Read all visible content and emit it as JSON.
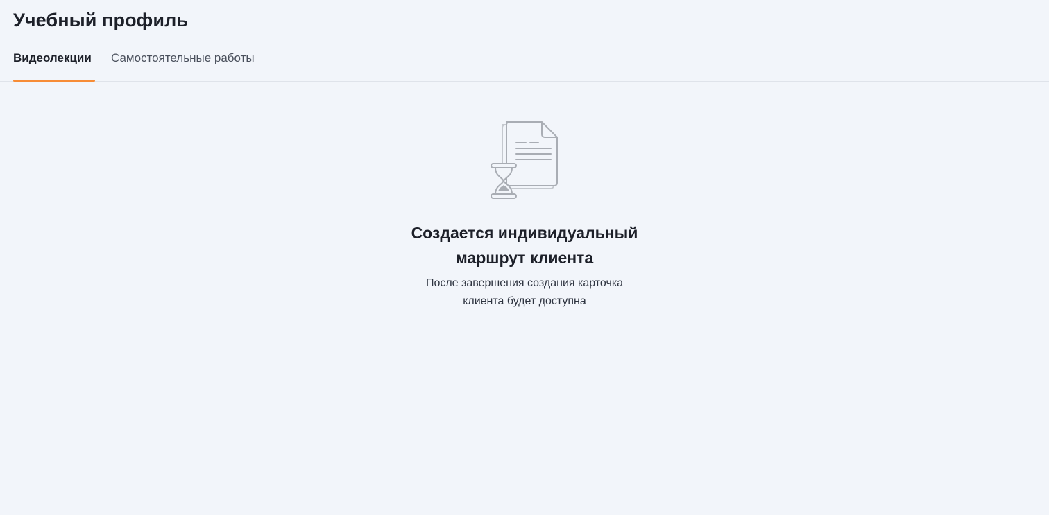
{
  "page": {
    "title": "Учебный профиль"
  },
  "tabs": [
    {
      "label": "Видеолекции",
      "active": true
    },
    {
      "label": "Самостоятельные работы",
      "active": false
    }
  ],
  "empty_state": {
    "icon": "document-hourglass-icon",
    "title_line1": "Создается индивидуальный",
    "title_line2": "маршрут клиента",
    "subtitle_line1": "После завершения создания карточка",
    "subtitle_line2": "клиента будет доступна"
  },
  "colors": {
    "background": "#f2f5fa",
    "accent": "#f78c36",
    "text_primary": "#1d2029",
    "icon_stroke": "#a9adb4"
  }
}
